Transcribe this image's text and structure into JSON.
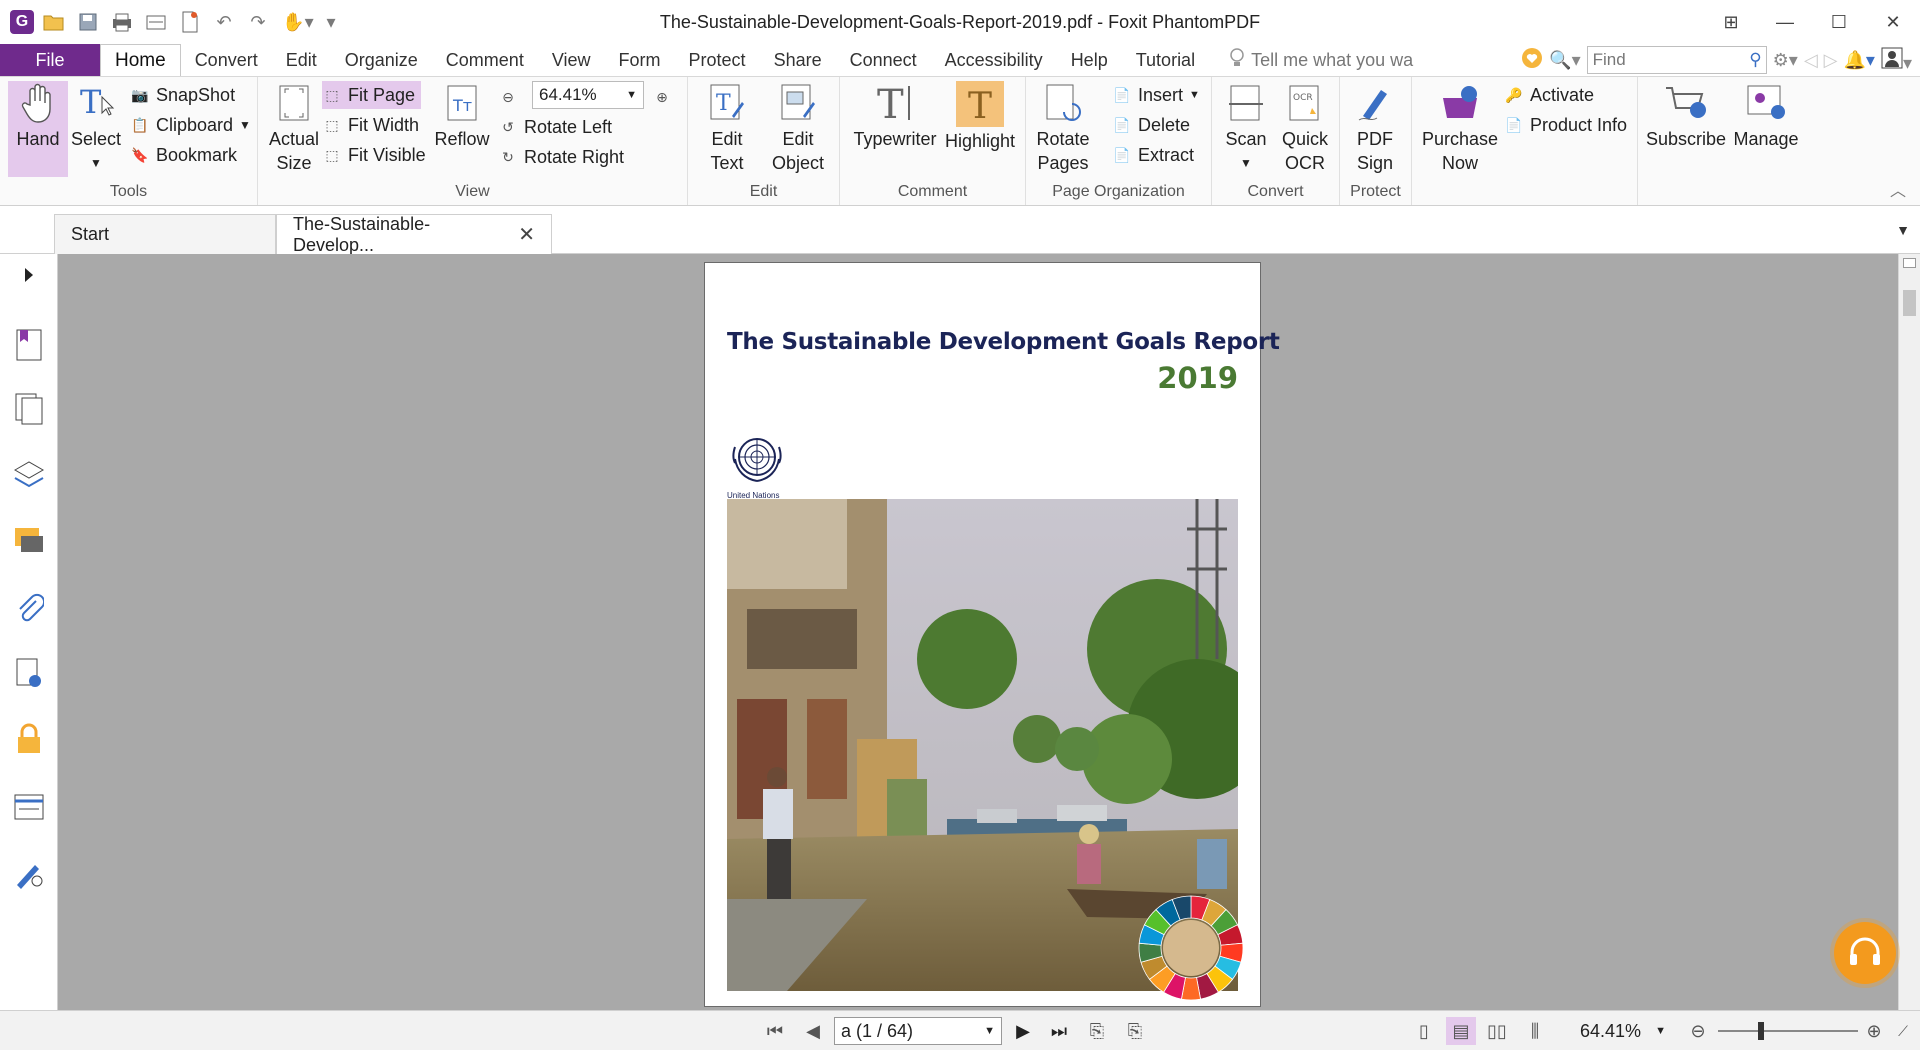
{
  "window": {
    "title": "The-Sustainable-Development-Goals-Report-2019.pdf - Foxit PhantomPDF"
  },
  "menu": {
    "file": "File",
    "tabs": [
      "Home",
      "Convert",
      "Edit",
      "Organize",
      "Comment",
      "View",
      "Form",
      "Protect",
      "Share",
      "Connect",
      "Accessibility",
      "Help",
      "Tutorial"
    ],
    "active": "Home",
    "tell_me": "Tell me what you wa",
    "find_placeholder": "Find"
  },
  "ribbon": {
    "tools": {
      "label": "Tools",
      "hand": "Hand",
      "select": "Select",
      "snapshot": "SnapShot",
      "clipboard": "Clipboard",
      "bookmark": "Bookmark"
    },
    "view": {
      "label": "View",
      "actual_size_1": "Actual",
      "actual_size_2": "Size",
      "fit_page": "Fit Page",
      "fit_width": "Fit Width",
      "fit_visible": "Fit Visible",
      "reflow": "Reflow",
      "zoom": "64.41%",
      "rotate_left": "Rotate Left",
      "rotate_right": "Rotate Right"
    },
    "edit": {
      "label": "Edit",
      "edit_text_1": "Edit",
      "edit_text_2": "Text",
      "edit_object_1": "Edit",
      "edit_object_2": "Object"
    },
    "comment": {
      "label": "Comment",
      "typewriter": "Typewriter",
      "highlight": "Highlight"
    },
    "page_org": {
      "label": "Page Organization",
      "rotate_pages_1": "Rotate",
      "rotate_pages_2": "Pages",
      "insert": "Insert",
      "delete": "Delete",
      "extract": "Extract"
    },
    "convert": {
      "label": "Convert",
      "scan": "Scan",
      "quick_ocr_1": "Quick",
      "quick_ocr_2": "OCR"
    },
    "protect": {
      "label": "Protect",
      "pdf_sign_1": "PDF",
      "pdf_sign_2": "Sign"
    },
    "purchase": {
      "purchase_now_1": "Purchase",
      "purchase_now_2": "Now",
      "activate": "Activate",
      "product_info": "Product Info"
    },
    "subscribe": {
      "subscribe": "Subscribe",
      "manage": "Manage"
    }
  },
  "doc_tabs": [
    {
      "label": "Start"
    },
    {
      "label": "The-Sustainable-Develop..."
    }
  ],
  "document": {
    "title": "The Sustainable Development Goals Report",
    "year": "2019",
    "publisher": "United Nations"
  },
  "status": {
    "page_indicator": "a (1 / 64)",
    "zoom": "64.41%"
  },
  "colors": {
    "brand_purple": "#6f2a8c",
    "highlight": "#e4c9ec",
    "title_navy": "#1b2457",
    "year_green": "#4a7a33",
    "workspace": "#a9a9a9",
    "support_orange": "#f39a1e"
  },
  "icons": [
    "app-logo-icon",
    "open-icon",
    "save-icon",
    "print-icon",
    "undo-icon",
    "redo-icon",
    "hand-icon",
    "search-icon",
    "gear-icon",
    "bell-icon",
    "user-icon",
    "close-icon",
    "pages-icon",
    "layers-icon",
    "comments-icon",
    "attachment-icon",
    "lock-icon",
    "headset-icon"
  ]
}
